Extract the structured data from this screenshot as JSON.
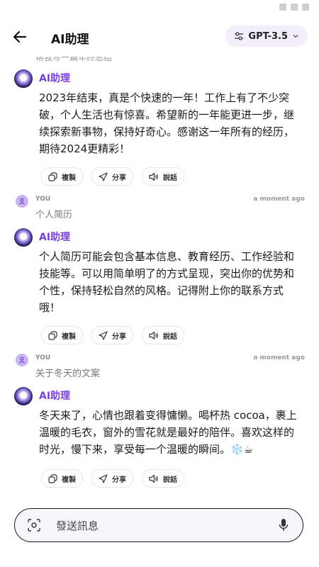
{
  "header": {
    "title": "AI助理",
    "model": "GPT-3.5"
  },
  "chat": {
    "cut_text": "帮我写一篇年终总结",
    "messages": [
      {
        "bot_name": "AI助理",
        "text": "2023年结束，真是个快速的一年！工作上有了不少突破，个人生活也有惊喜。希望新的一年能更进一步，继续探索新事物，保持好奇心。感谢这一年所有的经历，期待2024更精彩！"
      },
      {
        "user_name": "YOU",
        "time": "a moment ago",
        "text": "个人简历"
      },
      {
        "bot_name": "AI助理",
        "text": "个人简历可能会包含基本信息、教育经历、工作经验和技能等。可以用简单明了的方式呈现，突出你的优势和个性，保持轻松自然的风格。记得附上你的联系方式哦！"
      },
      {
        "user_name": "YOU",
        "time": "a moment ago",
        "text": "关于冬天的文案"
      },
      {
        "bot_name": "AI助理",
        "text": "冬天来了，心情也跟着变得慵懒。喝杯热 cocoa，裹上温暖的毛衣，窗外的雪花就是最好的陪伴。喜欢这样的时光，慢下来，享受每一个温暖的瞬间。❄️☕"
      }
    ]
  },
  "actions": {
    "copy": "複製",
    "share": "分享",
    "speak": "說話"
  },
  "composer": {
    "placeholder": "發送訊息"
  },
  "icons": {
    "back": "arrow-left-icon",
    "model": "sliders-icon",
    "dropdown": "chevron-down-icon",
    "copy": "copy-icon",
    "share": "send-icon",
    "speak": "speaker-icon",
    "camera": "camera-icon",
    "mic": "microphone-icon",
    "user": "user-icon"
  },
  "colors": {
    "accent": "#7b3fe4",
    "pill_bg": "#f2effa",
    "user_avatar": "#c7b3f5"
  }
}
